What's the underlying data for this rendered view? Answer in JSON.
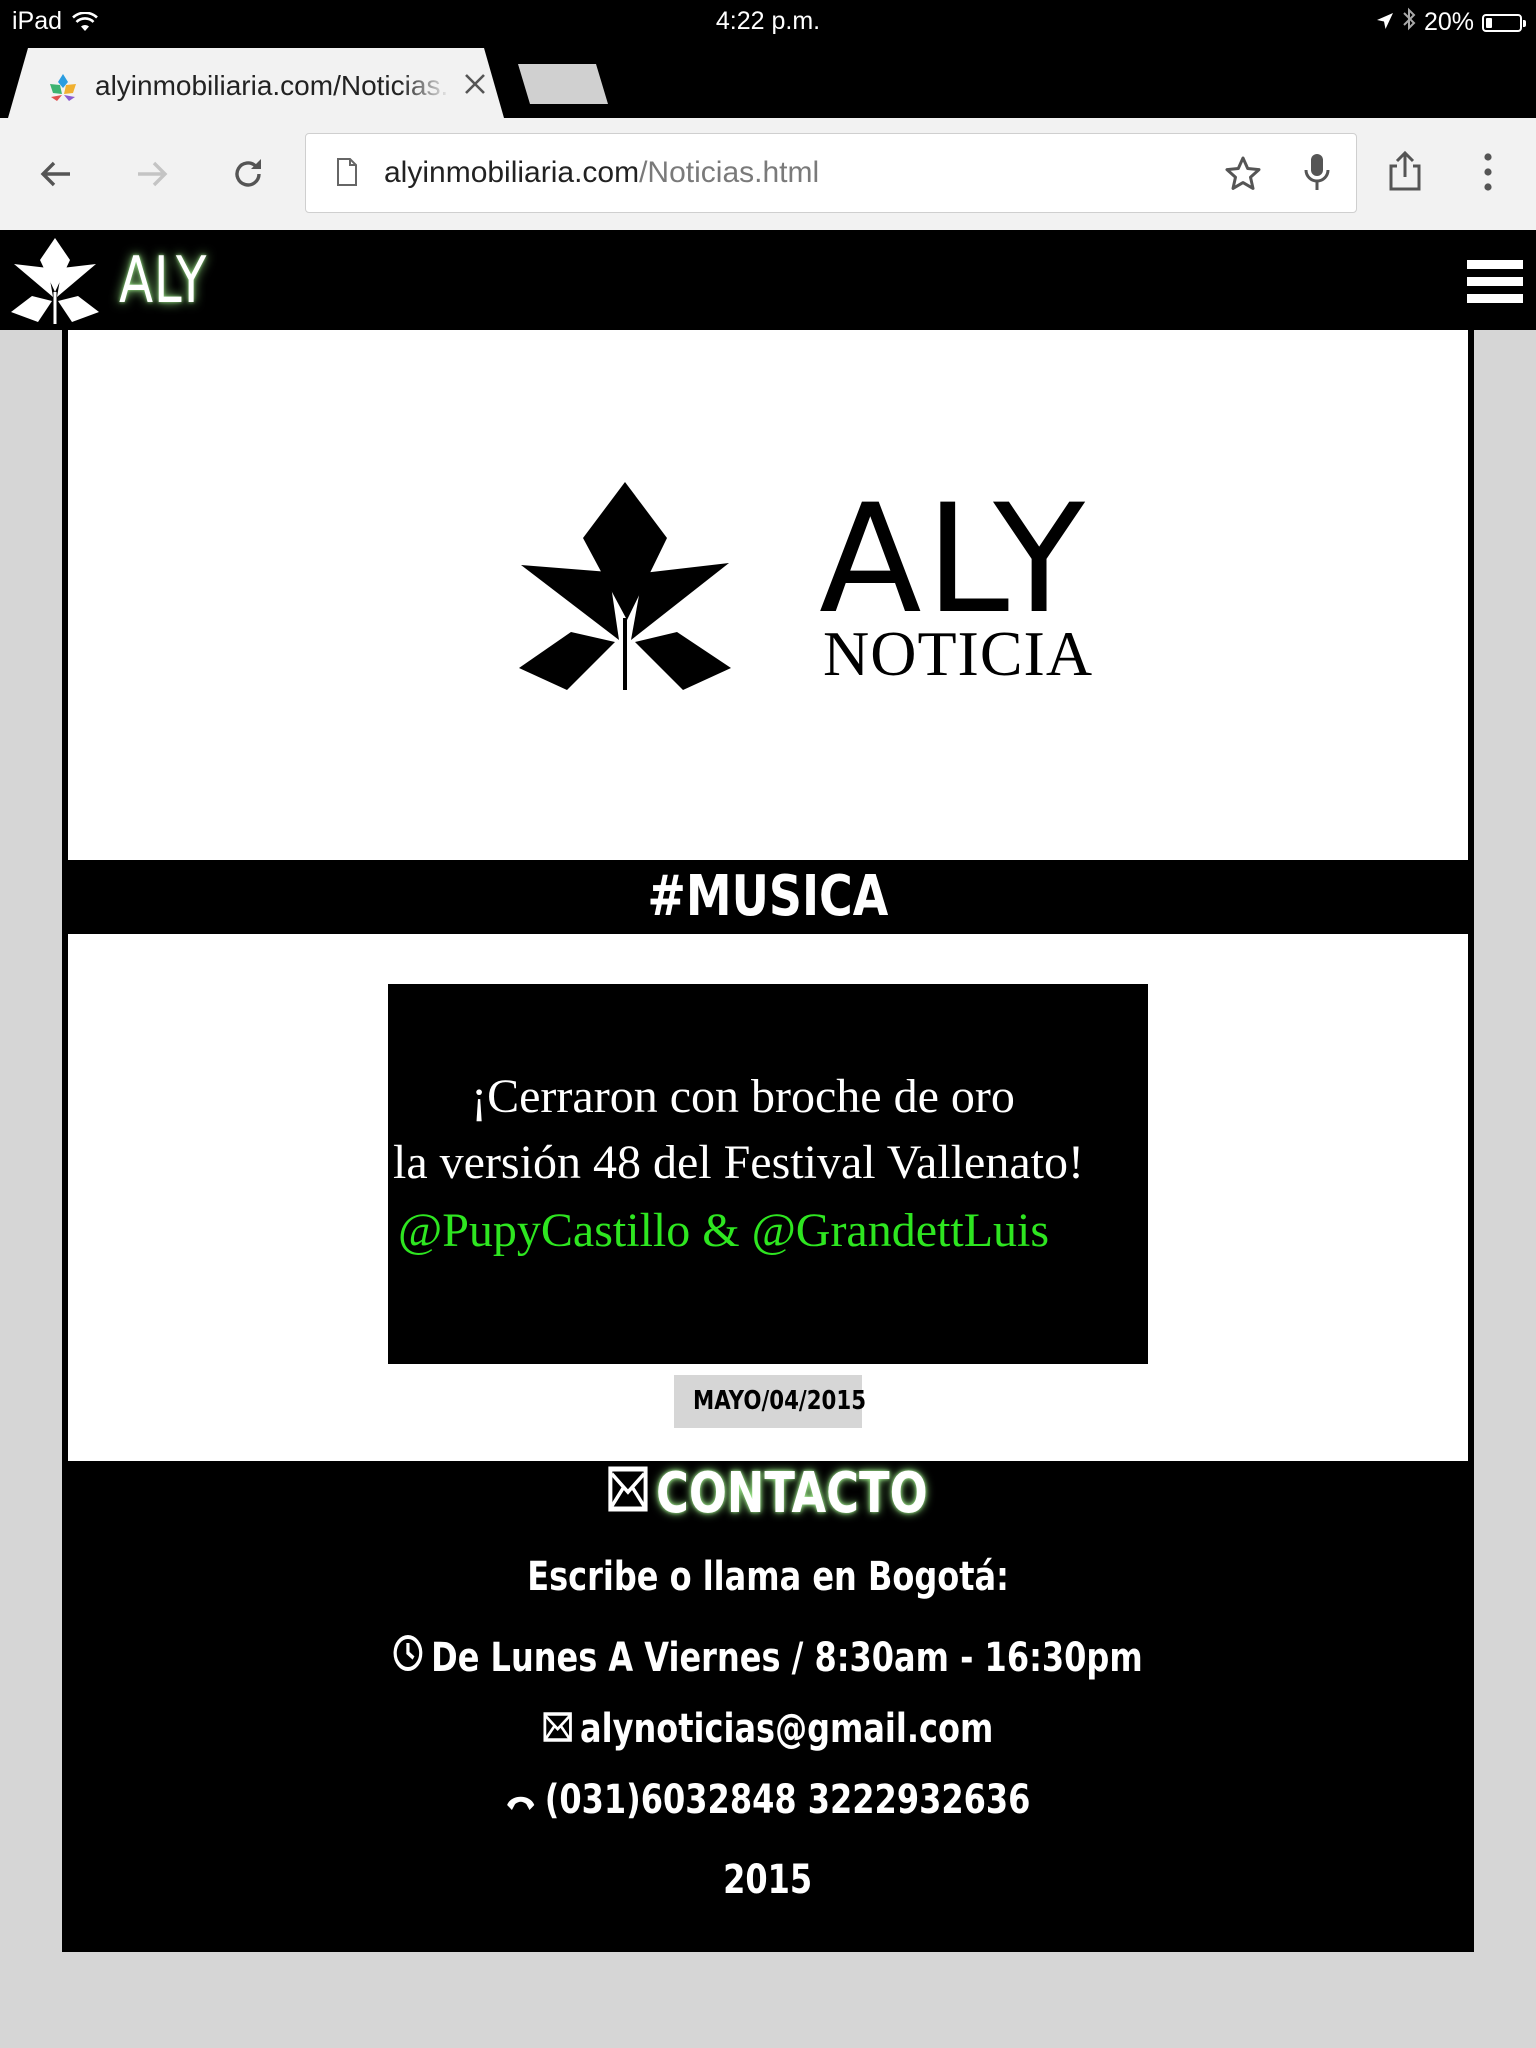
{
  "status_bar": {
    "device": "iPad",
    "time": "4:22 p.m.",
    "battery": "20%",
    "battery_level": 0.2
  },
  "browser": {
    "tab_title": "alyinmobiliaria.com/Noticias.html",
    "url_domain": "alyinmobiliaria.com",
    "url_path": "/Noticias.html"
  },
  "site_nav": {
    "brand": "ALY"
  },
  "hero": {
    "logo_title": "ALY",
    "logo_subtitle": "NOTICIA"
  },
  "category": "#MUSICA",
  "article": {
    "headline_line1": "¡Cerraron con broche de oro",
    "headline_line2": "la versión 48 del Festival Vallenato!",
    "mentions": "@PupyCastillo & @GrandettLuis",
    "date": "MAYO/04/2015"
  },
  "contact": {
    "heading": "CONTACTO",
    "intro": "Escribe o llama en Bogotá:",
    "hours": "De Lunes A Viernes / 8:30am - 16:30pm",
    "email": "alynoticias@gmail.com",
    "phone": "(031)6032848 3222932636",
    "year": "2015"
  },
  "colors": {
    "accent_green": "#2ee620",
    "glow_green": "#aaff96",
    "page_background": "#d6d6d6"
  }
}
